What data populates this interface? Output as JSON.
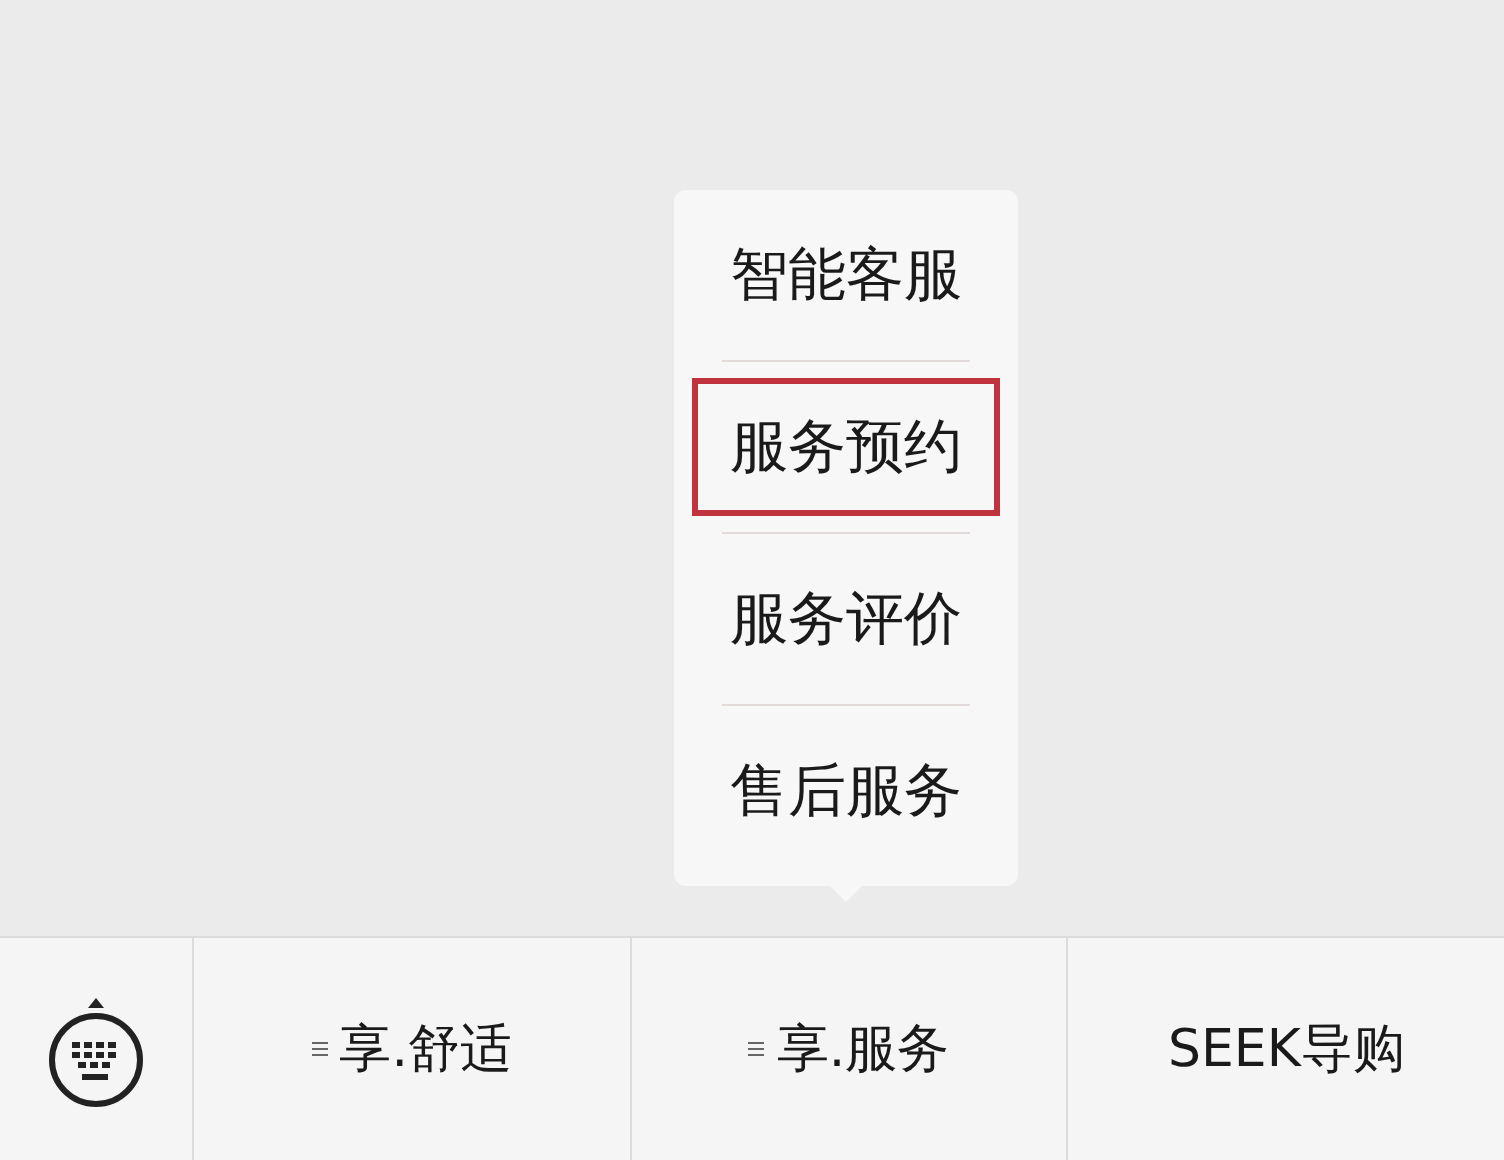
{
  "popup_menu": {
    "items": [
      {
        "label": "智能客服",
        "highlighted": false
      },
      {
        "label": "服务预约",
        "highlighted": true
      },
      {
        "label": "服务评价",
        "highlighted": false
      },
      {
        "label": "售后服务",
        "highlighted": false
      }
    ]
  },
  "menu_bar": {
    "items": [
      {
        "label": "享.舒适",
        "has_submenu": true
      },
      {
        "label": "享.服务",
        "has_submenu": true
      },
      {
        "label": "SEEK导购",
        "has_submenu": false
      }
    ]
  }
}
